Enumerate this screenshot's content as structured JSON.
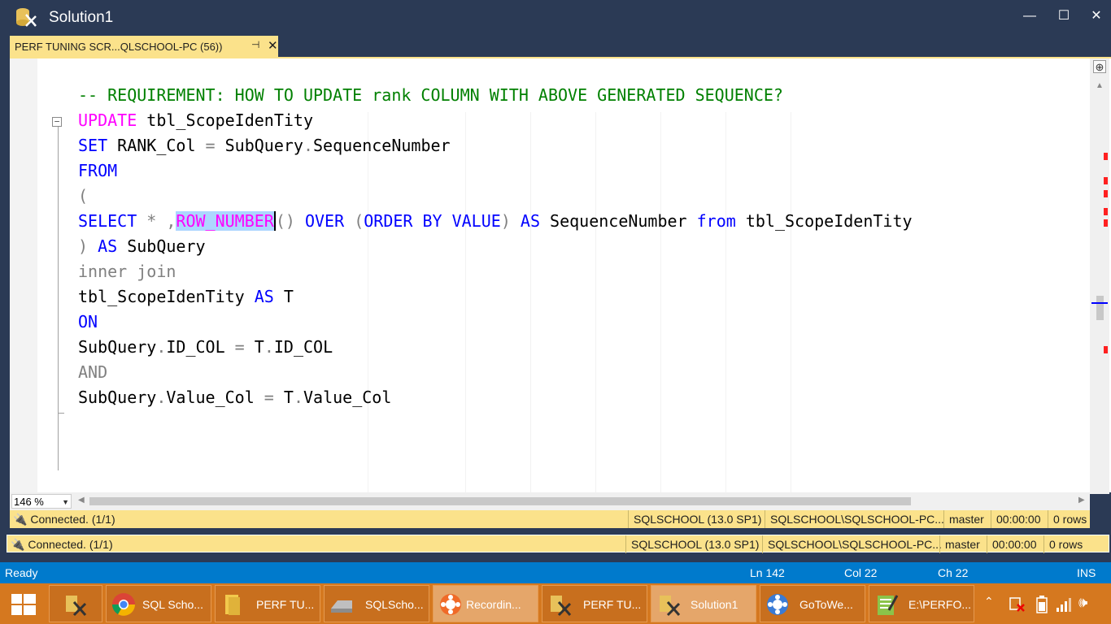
{
  "window": {
    "title": "Solution1",
    "minimize": "—",
    "maximize": "☐",
    "close": "✕"
  },
  "document_tab": {
    "label": "PERF TUNING  SCR...QLSCHOOL-PC (56))",
    "pin": "⊣",
    "close": "✕"
  },
  "editor": {
    "lines": {
      "l1": "-- REQUIREMENT: HOW TO UPDATE rank COLUMN WITH ABOVE GENERATED SEQUENCE?",
      "l2_kw": "UPDATE",
      "l2_rest": " tbl_ScopeIdenTity",
      "l3_kw": "SET",
      "l3_a": " RANK_Col ",
      "l3_eq": "=",
      "l3_b": " SubQuery",
      "l3_dot": ".",
      "l3_c": "SequenceNumber",
      "l4_kw": "FROM",
      "l5": "(",
      "l6_select": "SELECT",
      "l6_star": " * ,",
      "l6_rownum": "ROW_NUMBER",
      "l6_parens": "()",
      "l6_over": " OVER ",
      "l6_open": "(",
      "l6_orderby": "ORDER BY VALUE",
      "l6_close": ")",
      "l6_as": " AS",
      "l6_seq": " SequenceNumber ",
      "l6_from": "from",
      "l6_tbl": " tbl_ScopeIdenTity",
      "l7_paren": ")",
      "l7_as": " AS",
      "l7_rest": " SubQuery",
      "l8": "inner join",
      "l9_a": "tbl_ScopeIdenTity ",
      "l9_as": "AS",
      "l9_b": " T",
      "l10_kw": "ON",
      "l11_a": "SubQuery",
      "l11_dot": ".",
      "l11_b": "ID_COL ",
      "l11_eq": "=",
      "l11_c": " T",
      "l11_dot2": ".",
      "l11_d": "ID_COL",
      "l12": "AND",
      "l13_a": "SubQuery",
      "l13_dot": ".",
      "l13_b": "Value_Col ",
      "l13_eq": "=",
      "l13_c": " T",
      "l13_dot2": ".",
      "l13_d": "Value_Col"
    },
    "collapse_glyph": "−"
  },
  "zoom": {
    "value": "146 %",
    "dropdown": "▼"
  },
  "query_status_1": {
    "connection": "Connected. (1/1)",
    "server": "SQLSCHOOL (13.0 SP1)",
    "login": "SQLSCHOOL\\SQLSCHOOL-PC...",
    "database": "master",
    "elapsed": "00:00:00",
    "rows": "0 rows"
  },
  "query_status_2": {
    "connection": "Connected. (1/1)",
    "server": "SQLSCHOOL (13.0 SP1)",
    "login": "SQLSCHOOL\\SQLSCHOOL-PC...",
    "database": "master",
    "elapsed": "00:00:00",
    "rows": "0 rows"
  },
  "status_bar": {
    "state": "Ready",
    "line": "Ln 142",
    "col": "Col 22",
    "ch": "Ch 22",
    "mode": "INS"
  },
  "taskbar": {
    "items": [
      {
        "label": "SQL Scho...",
        "icon": "chrome-icon"
      },
      {
        "label": "PERF TU...",
        "icon": "folder-icon"
      },
      {
        "label": "SQLScho...",
        "icon": "drive-icon"
      },
      {
        "label": "Recordin...",
        "icon": "gotomeeting-icon"
      },
      {
        "label": "PERF TU...",
        "icon": "ssms-icon"
      },
      {
        "label": "Solution1",
        "icon": "ssms-icon"
      },
      {
        "label": "GoToWe...",
        "icon": "gotowebinar-icon"
      },
      {
        "label": "E:\\PERFO...",
        "icon": "notepad-icon"
      }
    ],
    "tray": {
      "chevron": "⌃",
      "volume": "🕪"
    }
  },
  "colors": {
    "accent_yellow": "#fbe28b",
    "status_blue": "#007acc",
    "taskbar_orange": "#d5781f",
    "keyword_blue": "#0000ff",
    "function_magenta": "#ff00ff",
    "comment_green": "#008000"
  }
}
